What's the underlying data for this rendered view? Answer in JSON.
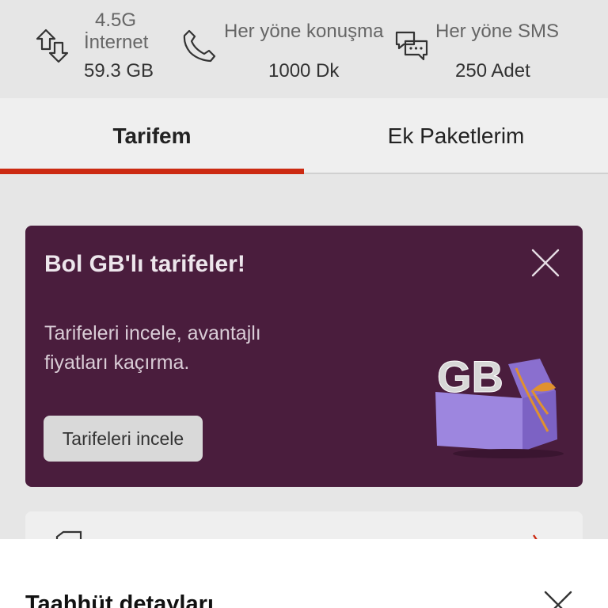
{
  "usage": {
    "internet": {
      "label_line1": "4.5G",
      "label_line2": "İnternet",
      "value": "59.3 GB",
      "icon": "data-transfer-arrows-icon"
    },
    "calls": {
      "label": "Her yöne konuşma",
      "value": "1000 Dk",
      "icon": "phone-icon"
    },
    "sms": {
      "label": "Her yöne SMS",
      "value": "250 Adet",
      "icon": "chat-bubbles-icon"
    }
  },
  "tabs": [
    {
      "label": "Tarifem",
      "active": true
    },
    {
      "label": "Ek Paketlerim",
      "active": false
    }
  ],
  "promo": {
    "title": "Bol GB'lı tarifeler!",
    "text": "Tarifeleri incele, avantajlı fiyatları kaçırma.",
    "button_label": "Tarifeleri incele",
    "illustration_text": "GB",
    "illustration": "gift-box-gb-illustration",
    "background_color": "#4a1d3d"
  },
  "bottom_sheet": {
    "title": "Taahhüt detayları"
  },
  "colors": {
    "accent": "#cc2a12",
    "promo_background": "#4a1d3d"
  }
}
